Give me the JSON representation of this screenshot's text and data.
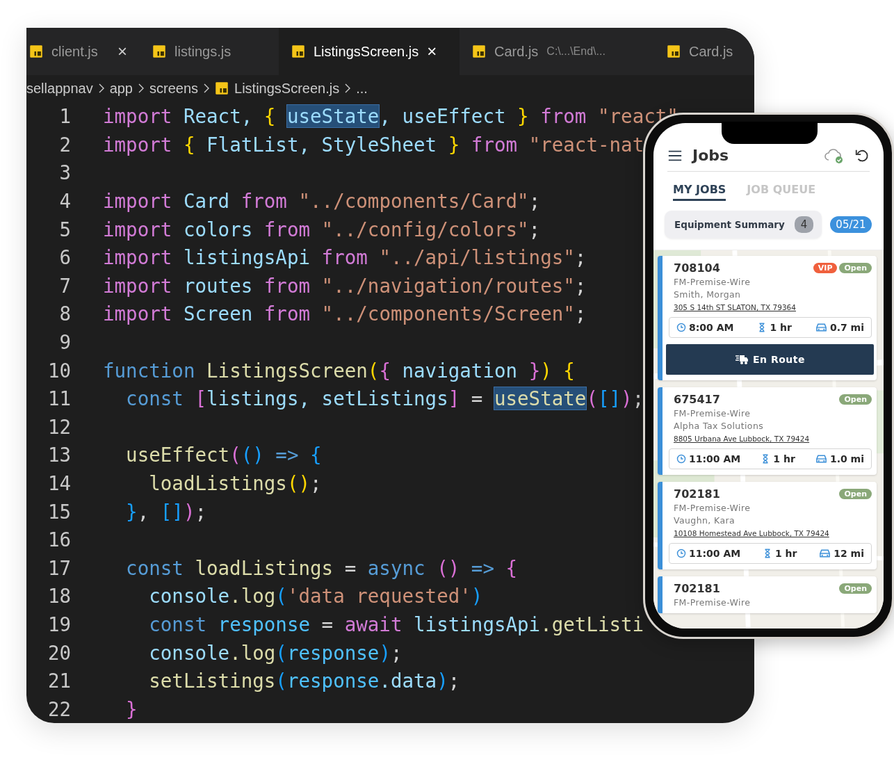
{
  "editor": {
    "tabs": [
      {
        "label": "client.js",
        "close": "×",
        "selected": false
      },
      {
        "label": "listings.js",
        "selected": false
      },
      {
        "label": "ListingsScreen.js",
        "close": "×",
        "selected": true
      },
      {
        "label": "Card.js",
        "detail": "C:\\...\\End\\...",
        "selected": false
      },
      {
        "label": "Card.js",
        "selected": false
      }
    ],
    "breadcrumb": [
      {
        "label": "sellappnav",
        "kind": "folder"
      },
      {
        "label": "app",
        "kind": "folder"
      },
      {
        "label": "screens",
        "kind": "folder"
      },
      {
        "label": "ListingsScreen.js",
        "kind": "file"
      },
      {
        "label": "...",
        "kind": "more"
      }
    ],
    "lines": [
      {
        "number": "1",
        "tokens": [
          {
            "text": "import",
            "kind": "kw"
          },
          {
            "text": " React, ",
            "kind": "var"
          },
          {
            "text": "{ ",
            "kind": "b1"
          },
          {
            "text": "useState",
            "kind": "var",
            "highlighted": true
          },
          {
            "text": ", useEffect ",
            "kind": "var"
          },
          {
            "text": "} ",
            "kind": "b1"
          },
          {
            "text": "from ",
            "kind": "kw"
          },
          {
            "text": "\"react\"",
            "kind": "str"
          }
        ]
      },
      {
        "number": "2",
        "tokens": [
          {
            "text": "import ",
            "kind": "kw"
          },
          {
            "text": "{",
            "kind": "b1"
          },
          {
            "text": " FlatList, StyleSheet ",
            "kind": "var"
          },
          {
            "text": "} ",
            "kind": "b1"
          },
          {
            "text": "from ",
            "kind": "kw"
          },
          {
            "text": "\"react-nat",
            "kind": "str"
          }
        ]
      },
      {
        "number": "3"
      },
      {
        "number": "4",
        "tokens": [
          {
            "text": "import",
            "kind": "kw"
          },
          {
            "text": " Card ",
            "kind": "var"
          },
          {
            "text": "from ",
            "kind": "kw"
          },
          {
            "text": "\"../components/Card\"",
            "kind": "str"
          },
          {
            "text": ";"
          }
        ]
      },
      {
        "number": "5",
        "tokens": [
          {
            "text": "import",
            "kind": "kw"
          },
          {
            "text": " colors ",
            "kind": "var"
          },
          {
            "text": "from ",
            "kind": "kw"
          },
          {
            "text": "\"../config/colors\"",
            "kind": "str"
          },
          {
            "text": ";"
          }
        ]
      },
      {
        "number": "6",
        "tokens": [
          {
            "text": "import",
            "kind": "kw"
          },
          {
            "text": " listingsApi ",
            "kind": "var"
          },
          {
            "text": "from ",
            "kind": "kw"
          },
          {
            "text": "\"../api/listings\"",
            "kind": "str"
          },
          {
            "text": ";"
          }
        ]
      },
      {
        "number": "7",
        "tokens": [
          {
            "text": "import",
            "kind": "kw"
          },
          {
            "text": " routes ",
            "kind": "var"
          },
          {
            "text": "from ",
            "kind": "kw"
          },
          {
            "text": "\"../navigation/routes\"",
            "kind": "str"
          },
          {
            "text": ";"
          }
        ]
      },
      {
        "number": "8",
        "tokens": [
          {
            "text": "import",
            "kind": "kw"
          },
          {
            "text": " Screen ",
            "kind": "var"
          },
          {
            "text": "from ",
            "kind": "kw"
          },
          {
            "text": "\"../components/Screen\"",
            "kind": "str"
          },
          {
            "text": ";"
          }
        ]
      },
      {
        "number": "9"
      },
      {
        "number": "10",
        "tokens": [
          {
            "text": "function ",
            "kind": "storage"
          },
          {
            "text": "ListingsScreen",
            "kind": "fn"
          },
          {
            "text": "(",
            "kind": "b1"
          },
          {
            "text": "{",
            "kind": "b2"
          },
          {
            "text": " navigation ",
            "kind": "var"
          },
          {
            "text": "}",
            "kind": "b2"
          },
          {
            "text": ")",
            "kind": "b1"
          },
          {
            "text": " {",
            "kind": "b1"
          }
        ]
      },
      {
        "number": "11",
        "tokens": [
          {
            "text": "  const ",
            "kind": "storage"
          },
          {
            "text": "[",
            "kind": "b2"
          },
          {
            "text": "listings, setListings",
            "kind": "var"
          },
          {
            "text": "]",
            "kind": "b2"
          },
          {
            "text": " = "
          },
          {
            "text": "useState",
            "kind": "fn",
            "highlighted": true
          },
          {
            "text": "(",
            "kind": "b2"
          },
          {
            "text": "[]",
            "kind": "b3"
          },
          {
            "text": ")",
            "kind": "b2"
          },
          {
            "text": ";"
          }
        ]
      },
      {
        "number": "12"
      },
      {
        "number": "13",
        "tokens": [
          {
            "text": "  useEffect",
            "kind": "fn"
          },
          {
            "text": "(",
            "kind": "b2"
          },
          {
            "text": "()",
            "kind": "b3"
          },
          {
            "text": " => ",
            "kind": "storage"
          },
          {
            "text": "{",
            "kind": "b3"
          }
        ]
      },
      {
        "number": "14",
        "tokens": [
          {
            "text": "    loadListings",
            "kind": "fn"
          },
          {
            "text": "()",
            "kind": "b1"
          },
          {
            "text": ";"
          }
        ]
      },
      {
        "number": "15",
        "tokens": [
          {
            "text": "  }",
            "kind": "b3"
          },
          {
            "text": ", "
          },
          {
            "text": "[]",
            "kind": "b3"
          },
          {
            "text": ")",
            "kind": "b2"
          },
          {
            "text": ";"
          }
        ]
      },
      {
        "number": "16"
      },
      {
        "number": "17",
        "tokens": [
          {
            "text": "  const ",
            "kind": "storage"
          },
          {
            "text": "loadListings",
            "kind": "fn"
          },
          {
            "text": " = "
          },
          {
            "text": "async ",
            "kind": "storage"
          },
          {
            "text": "()",
            "kind": "b2"
          },
          {
            "text": " => ",
            "kind": "storage"
          },
          {
            "text": "{",
            "kind": "b2"
          }
        ]
      },
      {
        "number": "18",
        "tokens": [
          {
            "text": "    console",
            "kind": "var"
          },
          {
            "text": ".log",
            "kind": "fn"
          },
          {
            "text": "(",
            "kind": "b3"
          },
          {
            "text": "'data requested'",
            "kind": "str"
          },
          {
            "text": ")",
            "kind": "b3"
          }
        ]
      },
      {
        "number": "19",
        "tokens": [
          {
            "text": "    const ",
            "kind": "storage"
          },
          {
            "text": "response",
            "kind": "const"
          },
          {
            "text": " = "
          },
          {
            "text": "await ",
            "kind": "kw"
          },
          {
            "text": "listingsApi",
            "kind": "var"
          },
          {
            "text": ".getListi",
            "kind": "fn"
          }
        ]
      },
      {
        "number": "20",
        "tokens": [
          {
            "text": "    console",
            "kind": "var"
          },
          {
            "text": ".log",
            "kind": "fn"
          },
          {
            "text": "(",
            "kind": "b3"
          },
          {
            "text": "response",
            "kind": "const"
          },
          {
            "text": ")",
            "kind": "b3"
          },
          {
            "text": ";"
          }
        ]
      },
      {
        "number": "21",
        "tokens": [
          {
            "text": "    setListings",
            "kind": "fn"
          },
          {
            "text": "(",
            "kind": "b3"
          },
          {
            "text": "response",
            "kind": "const"
          },
          {
            "text": ".data",
            "kind": "var"
          },
          {
            "text": ")",
            "kind": "b3"
          },
          {
            "text": ";"
          }
        ]
      },
      {
        "number": "22",
        "tokens": [
          {
            "text": "  }",
            "kind": "b2"
          }
        ]
      }
    ]
  },
  "phone": {
    "title": "Jobs",
    "tabs": [
      {
        "label": "MY JOBS",
        "selected": true
      },
      {
        "label": "JOB QUEUE",
        "selected": false
      }
    ],
    "summary": {
      "label": "Equipment Summary",
      "count": "4"
    },
    "date": "05/21",
    "jobs": [
      {
        "id": "708104",
        "tags": [
          {
            "label": "VIP",
            "kind": "vip"
          },
          {
            "label": "Open",
            "kind": "open"
          }
        ],
        "type": "FM-Premise-Wire",
        "customer": "Smith, Morgan",
        "address": "305 S 14th ST SLATON, TX 79364",
        "time": "8:00 AM",
        "duration": "1 hr",
        "distance": "0.7 mi",
        "action": "En Route"
      },
      {
        "id": "675417",
        "tags": [
          {
            "label": "Open",
            "kind": "open"
          }
        ],
        "type": "FM-Premise-Wire",
        "customer": "Alpha Tax Solutions",
        "address": "8805 Urbana Ave Lubbock, TX 79424",
        "time": "11:00 AM",
        "duration": "1 hr",
        "distance": "1.0 mi"
      },
      {
        "id": "702181",
        "tags": [
          {
            "label": "Open",
            "kind": "open"
          }
        ],
        "type": "FM-Premise-Wire",
        "customer": "Vaughn, Kara",
        "address": "10108 Homestead Ave Lubbock, TX 79424",
        "time": "11:00 AM",
        "duration": "1 hr",
        "distance": "12 mi"
      },
      {
        "id": "702181",
        "tags": [
          {
            "label": "Open",
            "kind": "open"
          }
        ],
        "type": "FM-Premise-Wire"
      }
    ]
  }
}
